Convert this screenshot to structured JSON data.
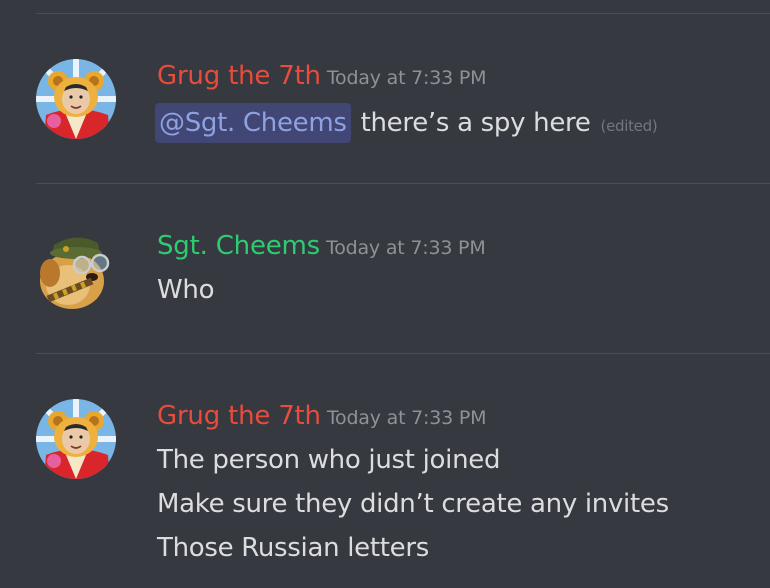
{
  "colors": {
    "background": "#36393f",
    "divider": "#4b4e55",
    "grug_name": "#e74c3c",
    "cheems_name": "#2ecc71",
    "message_text": "#dcddde",
    "timestamp": "#8e9297",
    "mention_bg": "#414675",
    "mention_text": "#8ea1e1"
  },
  "messages": [
    {
      "author": "Grug the 7th",
      "timestamp": "Today at 7:33 PM",
      "avatar_icon": "winnie-leader-avatar-icon",
      "mention": "@Sgt. Cheems",
      "text_after_mention": " there’s a spy here",
      "edited_label": "(edited)"
    },
    {
      "author": "Sgt. Cheems",
      "timestamp": "Today at 7:33 PM",
      "avatar_icon": "cheems-soldier-avatar-icon",
      "lines": [
        "Who"
      ]
    },
    {
      "author": "Grug the 7th",
      "timestamp": "Today at 7:33 PM",
      "avatar_icon": "winnie-leader-avatar-icon",
      "lines": [
        "The person who just joined",
        "Make sure they didn’t create any invites",
        "Those Russian letters"
      ]
    }
  ]
}
